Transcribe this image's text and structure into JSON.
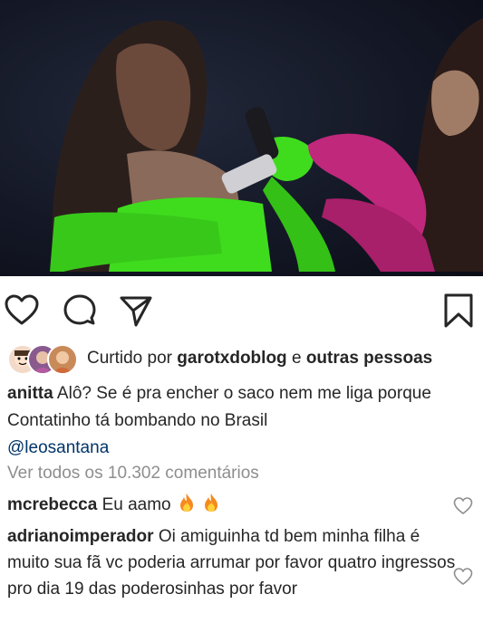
{
  "post": {
    "liked_by_prefix": "Curtido por",
    "liked_by_user": "garotxdoblog",
    "liked_by_connector": "e",
    "liked_by_others": "outras pessoas",
    "caption_user": "anitta",
    "caption_text": "Alô? Se é pra encher o saco nem me liga porque Contatinho tá bombando no Brasil",
    "caption_mention": "@leosantana",
    "view_all_comments": "Ver todos os 10.302 comentários"
  },
  "comments": [
    {
      "user": "mcrebecca",
      "text": "Eu aamo",
      "emoji": "fire-icon x2"
    },
    {
      "user": "adrianoimperador",
      "text": "Oi amiguinha td bem minha filha é muito sua fã vc poderia arrumar por favor quatro ingressos pro dia 19 das poderosinhas por favor"
    }
  ],
  "icons": [
    "heart-icon",
    "comment-icon",
    "share-icon",
    "bookmark-icon",
    "fire-icon"
  ],
  "colors": {
    "text": "#262626",
    "muted": "#8e8e8e",
    "mention": "#003569",
    "glove_green": "#3fdc1e",
    "glove_magenta": "#c0287c"
  }
}
